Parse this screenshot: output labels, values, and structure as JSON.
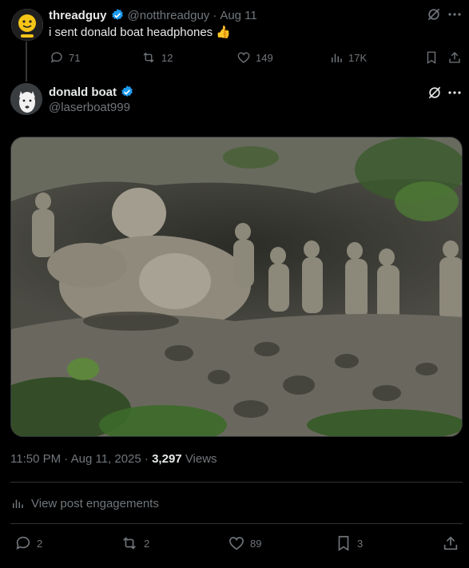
{
  "parent": {
    "name": "threadguy",
    "handle": "@notthreadguy",
    "separator": "·",
    "date": "Aug 11",
    "text": "i sent donald boat headphones",
    "emoji": "👍",
    "counts": {
      "replies": "71",
      "reposts": "12",
      "likes": "149",
      "views": "17K"
    }
  },
  "main": {
    "name": "donald boat",
    "handle": "@laserboat999",
    "time": "11:50 PM",
    "sep1": "·",
    "date": "Aug 11, 2025",
    "sep2": "·",
    "views_count": "3,297",
    "views_label": "Views",
    "engagements_label": "View post engagements",
    "counts": {
      "replies": "2",
      "reposts": "2",
      "likes": "89",
      "bookmarks": "3"
    }
  },
  "colors": {
    "verified": "#1d9bf0",
    "muted": "#71767b",
    "text": "#e7e9ea",
    "divider": "#2f3336"
  },
  "icons": [
    "verified-badge-icon",
    "grok-icon",
    "more-icon",
    "reply-icon",
    "repost-icon",
    "like-icon",
    "views-icon",
    "bookmark-icon",
    "share-icon"
  ]
}
